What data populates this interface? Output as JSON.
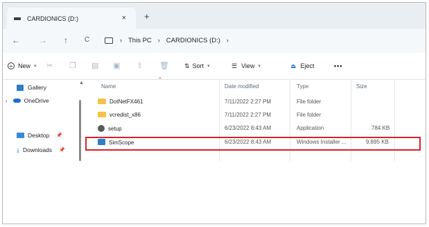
{
  "window": {
    "tab_title": "CARDIONICS (D:)",
    "tab_close": "×",
    "new_tab": "+"
  },
  "navigation": {
    "back": "←",
    "forward": "→",
    "up": "↑",
    "refresh": "C",
    "breadcrumb": [
      "This PC",
      "CARDIONICS (D:)"
    ],
    "separator": "›"
  },
  "commandbar": {
    "new_label": "New",
    "sort_label": "Sort",
    "view_label": "View",
    "eject_label": "Eject",
    "more_label": "•••"
  },
  "sidebar": {
    "items": [
      {
        "label": "Gallery",
        "pinned": false
      },
      {
        "label": "OneDrive",
        "pinned": false,
        "expandable": true
      },
      {
        "label": "Desktop",
        "pinned": true
      },
      {
        "label": "Downloads",
        "pinned": true
      }
    ]
  },
  "file_list": {
    "headers": {
      "name": "Name",
      "date": "Date modified",
      "type": "Type",
      "size": "Size"
    },
    "rows": [
      {
        "name": "DotNetFX461",
        "date": "7/11/2022 2:27 PM",
        "type": "File folder",
        "size": "",
        "icon": "folder-icon"
      },
      {
        "name": "vcredist_x86",
        "date": "7/11/2022 2:27 PM",
        "type": "File folder",
        "size": "",
        "icon": "folder-icon"
      },
      {
        "name": "setup",
        "date": "6/23/2022 8:43 AM",
        "type": "Application",
        "size": "784 KB",
        "icon": "setup-app-icon"
      },
      {
        "name": "SimScope",
        "date": "6/23/2022 8:43 AM",
        "type": "Windows Installer ...",
        "size": "9,895 KB",
        "icon": "installer-icon",
        "highlighted": true
      }
    ]
  },
  "colors": {
    "highlight": "#d9202a",
    "folder": "#f4c24a",
    "accent": "#2f7fc6"
  }
}
